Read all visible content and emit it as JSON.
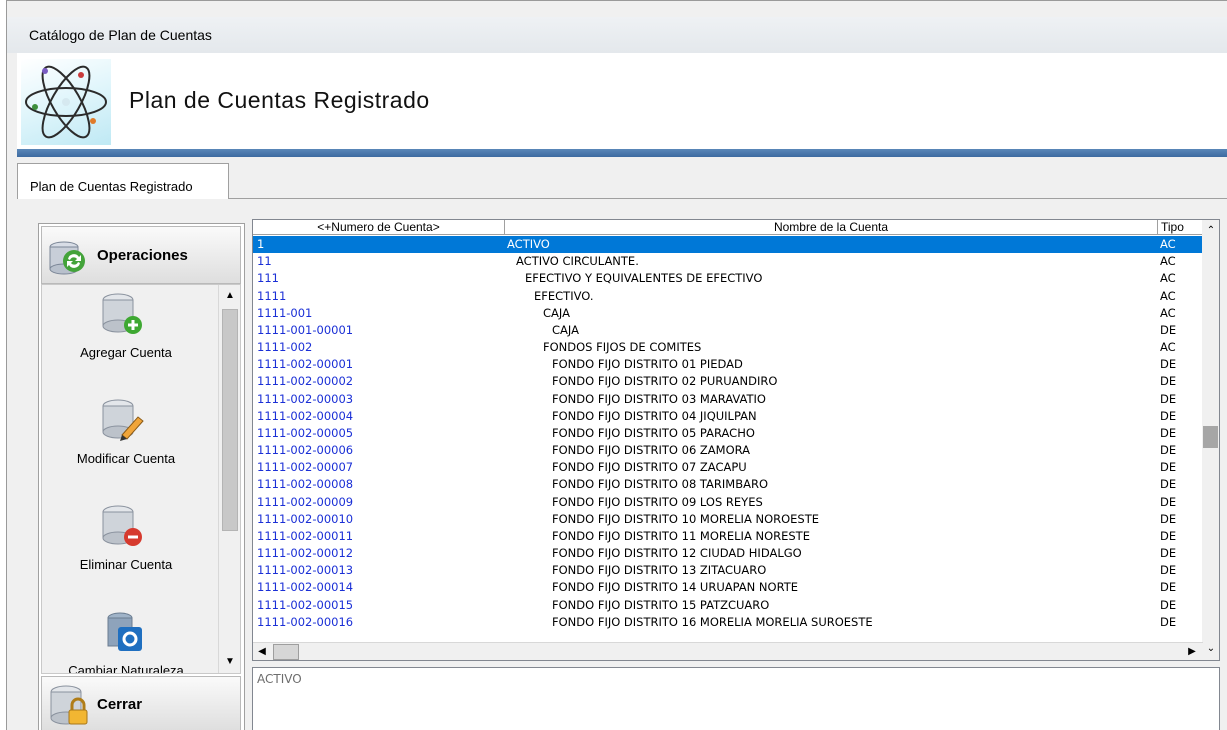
{
  "window": {
    "title": "Catálogo de Plan de Cuentas"
  },
  "header": {
    "title": "Plan de Cuentas Registrado"
  },
  "tabs": [
    {
      "label": "Plan de Cuentas Registrado"
    }
  ],
  "sidebar": {
    "operations_label": "Operaciones",
    "items": [
      {
        "label": "Agregar Cuenta",
        "icon": "database-add-icon"
      },
      {
        "label": "Modificar Cuenta",
        "icon": "database-edit-icon"
      },
      {
        "label": "Eliminar Cuenta",
        "icon": "database-delete-icon"
      },
      {
        "label": "Cambiar Naturaleza",
        "icon": "database-settings-icon"
      }
    ],
    "close_label": "Cerrar"
  },
  "grid": {
    "columns": [
      "<+Numero de Cuenta>",
      "Nombre de la Cuenta",
      "Tipo"
    ],
    "rows": [
      {
        "num": "1",
        "name": "ACTIVO",
        "tipo": "AC",
        "indent": 0,
        "selected": true
      },
      {
        "num": "11",
        "name": "ACTIVO CIRCULANTE.",
        "tipo": "AC",
        "indent": 1
      },
      {
        "num": "111",
        "name": "EFECTIVO Y EQUIVALENTES DE EFECTIVO",
        "tipo": "AC",
        "indent": 2
      },
      {
        "num": "1111",
        "name": "EFECTIVO.",
        "tipo": "AC",
        "indent": 3
      },
      {
        "num": "1111-001",
        "name": "CAJA",
        "tipo": "AC",
        "indent": 4
      },
      {
        "num": "1111-001-00001",
        "name": "CAJA",
        "tipo": "DE",
        "indent": 5
      },
      {
        "num": "1111-002",
        "name": "FONDOS FIJOS DE COMITES",
        "tipo": "AC",
        "indent": 4
      },
      {
        "num": "1111-002-00001",
        "name": "FONDO FIJO DISTRITO 01 PIEDAD",
        "tipo": "DE",
        "indent": 5
      },
      {
        "num": "1111-002-00002",
        "name": "FONDO FIJO DISTRITO 02 PURUANDIRO",
        "tipo": "DE",
        "indent": 5
      },
      {
        "num": "1111-002-00003",
        "name": "FONDO FIJO DISTRITO 03 MARAVATIO",
        "tipo": "DE",
        "indent": 5
      },
      {
        "num": "1111-002-00004",
        "name": "FONDO FIJO DISTRITO 04 JIQUILPAN",
        "tipo": "DE",
        "indent": 5
      },
      {
        "num": "1111-002-00005",
        "name": "FONDO FIJO DISTRITO 05 PARACHO",
        "tipo": "DE",
        "indent": 5
      },
      {
        "num": "1111-002-00006",
        "name": "FONDO FIJO DISTRITO 06 ZAMORA",
        "tipo": "DE",
        "indent": 5
      },
      {
        "num": "1111-002-00007",
        "name": "FONDO FIJO DISTRITO 07 ZACAPU",
        "tipo": "DE",
        "indent": 5
      },
      {
        "num": "1111-002-00008",
        "name": "FONDO FIJO DISTRITO 08 TARIMBARO",
        "tipo": "DE",
        "indent": 5
      },
      {
        "num": "1111-002-00009",
        "name": "FONDO FIJO DISTRITO 09 LOS REYES",
        "tipo": "DE",
        "indent": 5
      },
      {
        "num": "1111-002-00010",
        "name": "FONDO FIJO DISTRITO 10 MORELIA NOROESTE",
        "tipo": "DE",
        "indent": 5
      },
      {
        "num": "1111-002-00011",
        "name": "FONDO FIJO DISTRITO 11 MORELIA NORESTE",
        "tipo": "DE",
        "indent": 5
      },
      {
        "num": "1111-002-00012",
        "name": "FONDO FIJO DISTRITO 12 CIUDAD HIDALGO",
        "tipo": "DE",
        "indent": 5
      },
      {
        "num": "1111-002-00013",
        "name": "FONDO FIJO DISTRITO 13 ZITACUARO",
        "tipo": "DE",
        "indent": 5
      },
      {
        "num": "1111-002-00014",
        "name": "FONDO FIJO DISTRITO 14 URUAPAN NORTE",
        "tipo": "DE",
        "indent": 5
      },
      {
        "num": "1111-002-00015",
        "name": "FONDO FIJO DISTRITO 15 PATZCUARO",
        "tipo": "DE",
        "indent": 5
      },
      {
        "num": "1111-002-00016",
        "name": "FONDO FIJO DISTRITO 16 MORELIA MORELIA SUROESTE",
        "tipo": "DE",
        "indent": 5
      }
    ]
  },
  "detail": {
    "text": "ACTIVO"
  },
  "colors": {
    "selection": "#0078d7",
    "account_number": "#1a2fd6",
    "header_bar": "#3d6aa0"
  }
}
